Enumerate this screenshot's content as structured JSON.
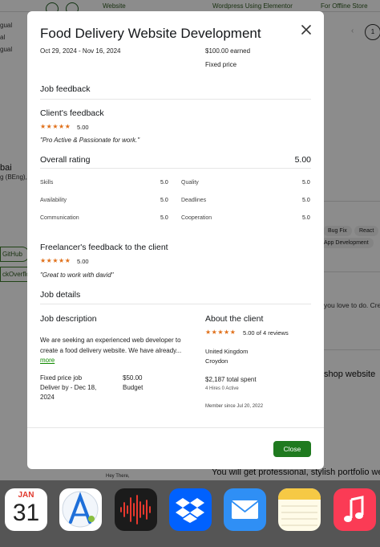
{
  "background": {
    "top_links": [
      "Website",
      "Wordpress Using Elementor",
      "For Offline Store"
    ],
    "left_snippets": [
      "gual",
      "al",
      "gual",
      "bai",
      "g (BEng),"
    ],
    "left_pills": [
      "GitHub",
      "ckOverflo"
    ],
    "chips": [
      "Bug Fix",
      "React",
      "App Development"
    ],
    "right_snippets": [
      "you love to do. Cre",
      "shop website",
      "You will get professional, stylish portfolio websi"
    ],
    "bottom_text": "Hey There,"
  },
  "modal": {
    "title": "Food Delivery Website Development",
    "dates": "Oct 29, 2024 - Nov 16, 2024",
    "earned": "$100.00 earned",
    "price_type": "Fixed price",
    "job_feedback_heading": "Job feedback",
    "client_feedback_heading": "Client's feedback",
    "client_stars": "★★★★★",
    "client_score": "5.00",
    "client_quote": "\"Pro Active & Passionate for work.\"",
    "overall_heading": "Overall rating",
    "overall_score": "5.00",
    "ratings": [
      {
        "label": "Skills",
        "value": "5.0"
      },
      {
        "label": "Quality",
        "value": "5.0"
      },
      {
        "label": "Availability",
        "value": "5.0"
      },
      {
        "label": "Deadlines",
        "value": "5.0"
      },
      {
        "label": "Communication",
        "value": "5.0"
      },
      {
        "label": "Cooperation",
        "value": "5.0"
      }
    ],
    "freelancer_feedback_heading": "Freelancer's feedback to the client",
    "freelancer_stars": "★★★★★",
    "freelancer_score": "5.00",
    "freelancer_quote": "\"Great to work with david\"",
    "job_details_heading": "Job details",
    "job_description_heading": "Job description",
    "job_description_line1": "We are seeking an experienced web developer to",
    "job_description_line2": "create a food delivery website. We have already...",
    "more_label": "more",
    "job_type": "Fixed price job",
    "job_amount": "$50.00",
    "deliver_by": "Deliver by - Dec 18,",
    "deliver_year": "2024",
    "budget_label": "Budget",
    "about_client_heading": "About the client",
    "client_reviews_stars": "★★★★★",
    "client_reviews": "5.00 of 4 reviews",
    "client_country": "United Kingdom",
    "client_city": "Croydon",
    "client_spent": "$2,187 total spent",
    "client_hires": "4 Hires 0 Active",
    "member_since": "Member since Jul 20, 2022",
    "close_label": "Close"
  },
  "dock": {
    "calendar_month": "JAN",
    "calendar_day": "31",
    "apps": [
      "calendar-icon",
      "xcode-instruments-icon",
      "voice-memos-icon",
      "dropbox-icon",
      "mail-icon",
      "notes-icon",
      "music-icon"
    ]
  },
  "colors": {
    "accent_green": "#1f7a1f",
    "star_orange": "#e0701a",
    "link_green": "#108a00"
  }
}
